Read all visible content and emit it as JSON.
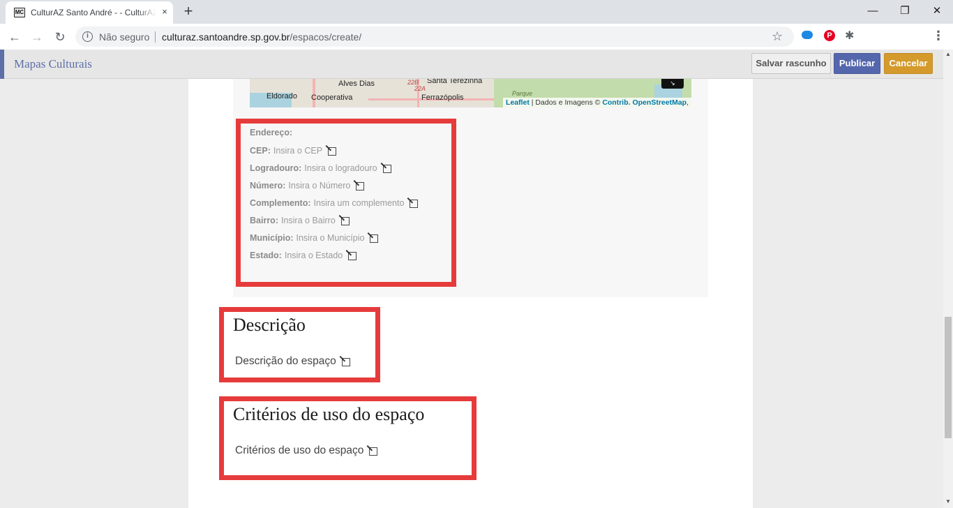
{
  "browser": {
    "tab": {
      "favicon": "MC",
      "title": "CulturAZ Santo André - - CulturAZ Santo André",
      "close_icon": "×"
    },
    "new_tab_icon": "+",
    "window_controls": {
      "minimize": "—",
      "restore": "❐",
      "close": "✕"
    },
    "nav": {
      "back_icon": "←",
      "forward_icon": "→",
      "reload_icon": "↻"
    },
    "omnibox": {
      "security_icon": "i",
      "security_label": "Não seguro",
      "url_host": "culturaz.santoandre.sp.gov.br",
      "url_path": "/espacos/create/",
      "bookmark_icon": "☆"
    },
    "extensions": {
      "pinterest_icon": "P",
      "puzzle_icon": "✱",
      "menu_icon": "⋮"
    }
  },
  "header": {
    "brand": "Mapas Culturais",
    "save_draft": "Salvar rascunho",
    "publish": "Publicar",
    "cancel": "Cancelar"
  },
  "map": {
    "labels": [
      "Alves Dias",
      "Santa Terezinha",
      "Eldorado",
      "Cooperativa",
      "Ferrazópolis",
      "Parque"
    ],
    "road_numbers": [
      "22B",
      "22A"
    ],
    "fullscreen_icon": "↘",
    "attribution": {
      "leaflet": "Leaflet",
      "sep": " | Dados e Imagens © ",
      "contrib": "Contrib.",
      "osm": " OpenStreetMap",
      "tail": ","
    }
  },
  "address": {
    "heading": "Endereço:",
    "fields": [
      {
        "label": "CEP:",
        "placeholder": "Insira o CEP"
      },
      {
        "label": "Logradouro:",
        "placeholder": "Insira o logradouro"
      },
      {
        "label": "Número:",
        "placeholder": "Insira o Número"
      },
      {
        "label": "Complemento:",
        "placeholder": "Insira um complemento"
      },
      {
        "label": "Bairro:",
        "placeholder": "Insira o Bairro"
      },
      {
        "label": "Município:",
        "placeholder": "Insira o Município"
      },
      {
        "label": "Estado:",
        "placeholder": "Insira o Estado"
      }
    ]
  },
  "description": {
    "title": "Descrição",
    "placeholder": "Descrição do espaço"
  },
  "criteria": {
    "title": "Critérios de uso do espaço",
    "placeholder": "Critérios de uso do espaço"
  },
  "colors": {
    "highlight": "#e63b3b",
    "brand": "#5e6fa8",
    "publish": "#5467ad",
    "cancel": "#d49a2c"
  }
}
